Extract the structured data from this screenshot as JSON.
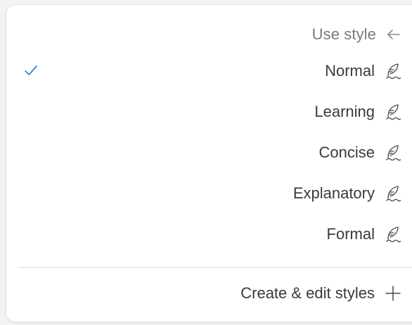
{
  "menu": {
    "header": {
      "label": "Use style",
      "icon": "arrow-left-icon"
    },
    "items": [
      {
        "label": "Normal",
        "selected": true,
        "icon": "feather-icon"
      },
      {
        "label": "Learning",
        "selected": false,
        "icon": "feather-icon"
      },
      {
        "label": "Concise",
        "selected": false,
        "icon": "feather-icon"
      },
      {
        "label": "Explanatory",
        "selected": false,
        "icon": "feather-icon"
      },
      {
        "label": "Formal",
        "selected": false,
        "icon": "feather-icon"
      }
    ],
    "footer": {
      "label": "Create & edit styles",
      "icon": "plus-icon"
    },
    "colors": {
      "check": "#3b82d6",
      "text": "#3b3a36",
      "muted": "#7b7a76"
    }
  }
}
